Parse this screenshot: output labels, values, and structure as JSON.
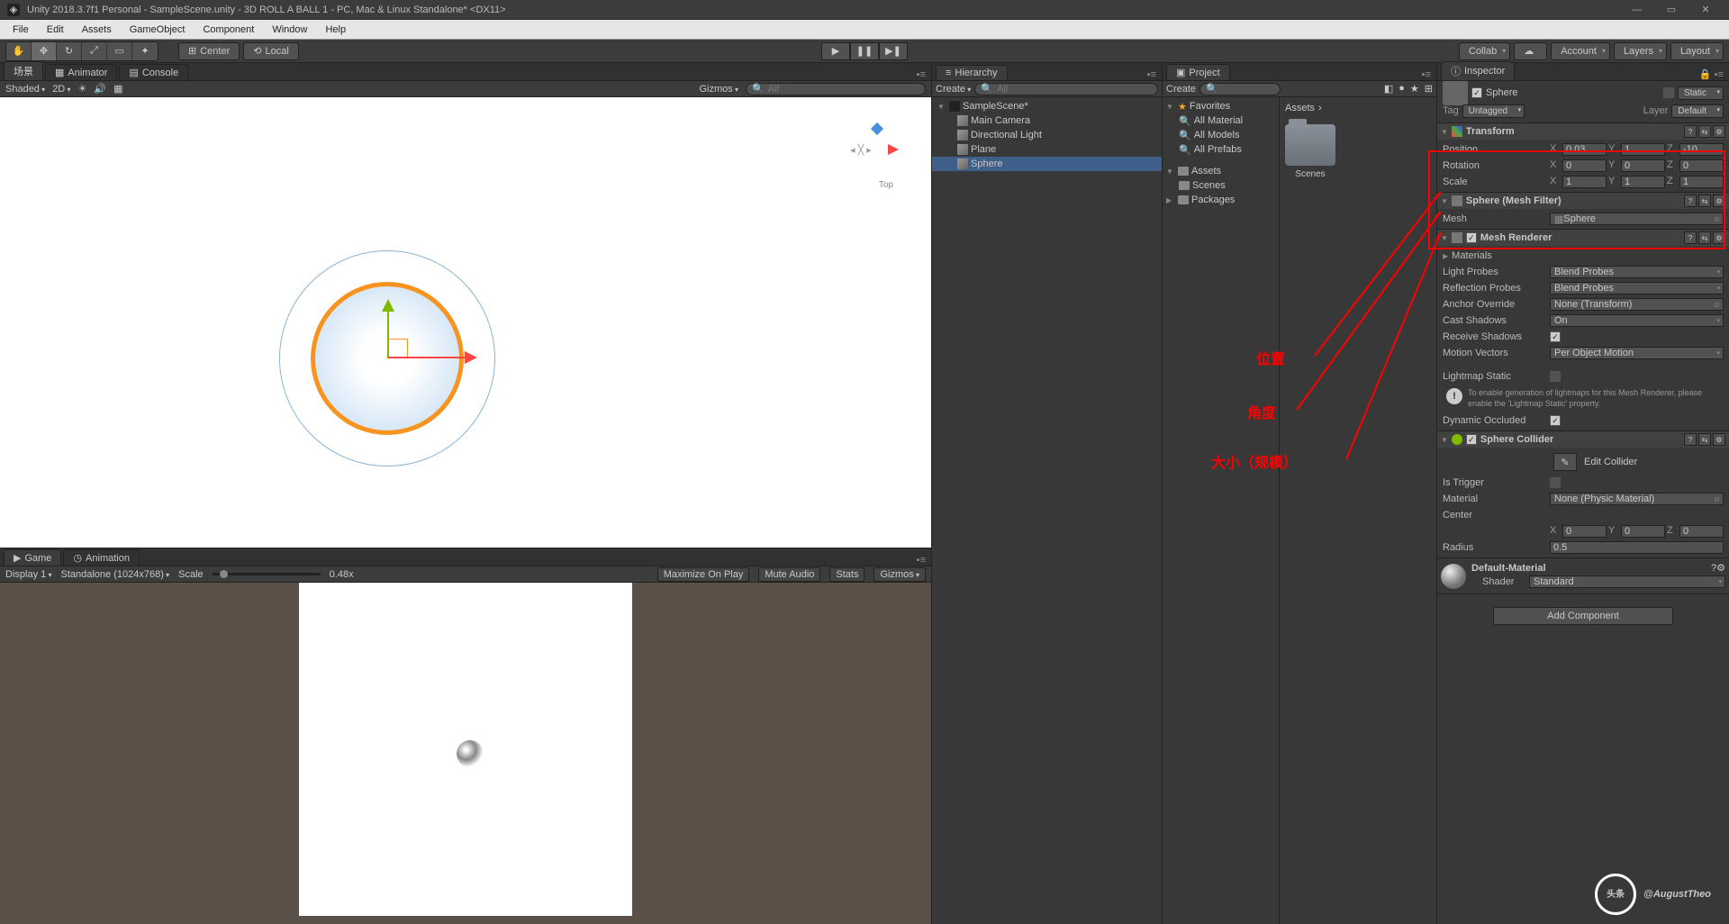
{
  "title": "Unity 2018.3.7f1 Personal - SampleScene.unity - 3D ROLL A BALL 1 - PC, Mac & Linux Standalone* <DX11>",
  "menu": [
    "File",
    "Edit",
    "Assets",
    "GameObject",
    "Component",
    "Window",
    "Help"
  ],
  "toolbar": {
    "center": "Center",
    "local": "Local",
    "collab": "Collab",
    "account": "Account",
    "layers": "Layers",
    "layout": "Layout"
  },
  "sceneTabs": {
    "scene": "场景",
    "animator": "Animator",
    "console": "Console"
  },
  "sceneTb": {
    "shaded": "Shaded",
    "mode": "2D",
    "gizmos": "Gizmos",
    "searchPh": "All"
  },
  "sceneGizmo": "Top",
  "gameTabs": {
    "game": "Game",
    "animation": "Animation"
  },
  "gameTb": {
    "display": "Display 1",
    "aspect": "Standalone (1024x768)",
    "scale": "Scale",
    "scaleVal": "0.48x",
    "maxplay": "Maximize On Play",
    "mute": "Mute Audio",
    "stats": "Stats",
    "gizmos": "Gizmos"
  },
  "hierarchy": {
    "tab": "Hierarchy",
    "create": "Create",
    "searchPh": "All",
    "scene": "SampleScene*",
    "items": [
      "Main Camera",
      "Directional Light",
      "Plane",
      "Sphere"
    ]
  },
  "project": {
    "tab": "Project",
    "create": "Create",
    "fav": "Favorites",
    "favs": [
      "All Material",
      "All Models",
      "All Prefabs"
    ],
    "assets": "Assets",
    "scenes": "Scenes",
    "packages": "Packages",
    "bc": "Assets",
    "folder": "Scenes"
  },
  "inspector": {
    "tab": "Inspector",
    "name": "Sphere",
    "static": "Static",
    "tagLbl": "Tag",
    "tag": "Untagged",
    "layerLbl": "Layer",
    "layer": "Default",
    "transform": {
      "title": "Transform",
      "position": "Position",
      "rotation": "Rotation",
      "scale": "Scale",
      "px": "0.03",
      "py": "1",
      "pz": "-10",
      "rx": "0",
      "ry": "0",
      "rz": "0",
      "sx": "1",
      "sy": "1",
      "sz": "1"
    },
    "meshfilter": {
      "title": "Sphere (Mesh Filter)",
      "mesh": "Mesh",
      "meshVal": "Sphere"
    },
    "renderer": {
      "title": "Mesh Renderer",
      "materials": "Materials",
      "lightProbes": "Light Probes",
      "lightProbesVal": "Blend Probes",
      "reflProbes": "Reflection Probes",
      "reflProbesVal": "Blend Probes",
      "anchor": "Anchor Override",
      "anchorVal": "None (Transform)",
      "cast": "Cast Shadows",
      "castVal": "On",
      "recv": "Receive Shadows",
      "motion": "Motion Vectors",
      "motionVal": "Per Object Motion",
      "lms": "Lightmap Static",
      "info": "To enable generation of lightmaps for this Mesh Renderer, please enable the 'Lightmap Static' property.",
      "dyn": "Dynamic Occluded"
    },
    "collider": {
      "title": "Sphere Collider",
      "edit": "Edit Collider",
      "trigger": "Is Trigger",
      "material": "Material",
      "materialVal": "None (Physic Material)",
      "center": "Center",
      "cx": "0",
      "cy": "0",
      "cz": "0",
      "radius": "Radius",
      "radiusVal": "0.5"
    },
    "mat": {
      "name": "Default-Material",
      "shader": "Shader",
      "shaderVal": "Standard"
    },
    "addComp": "Add Component"
  },
  "annot": {
    "pos": "位置",
    "rot": "角度",
    "scale": "大小（规模）"
  },
  "watermark": "@AugustTheo",
  "wmBubble": "头条"
}
